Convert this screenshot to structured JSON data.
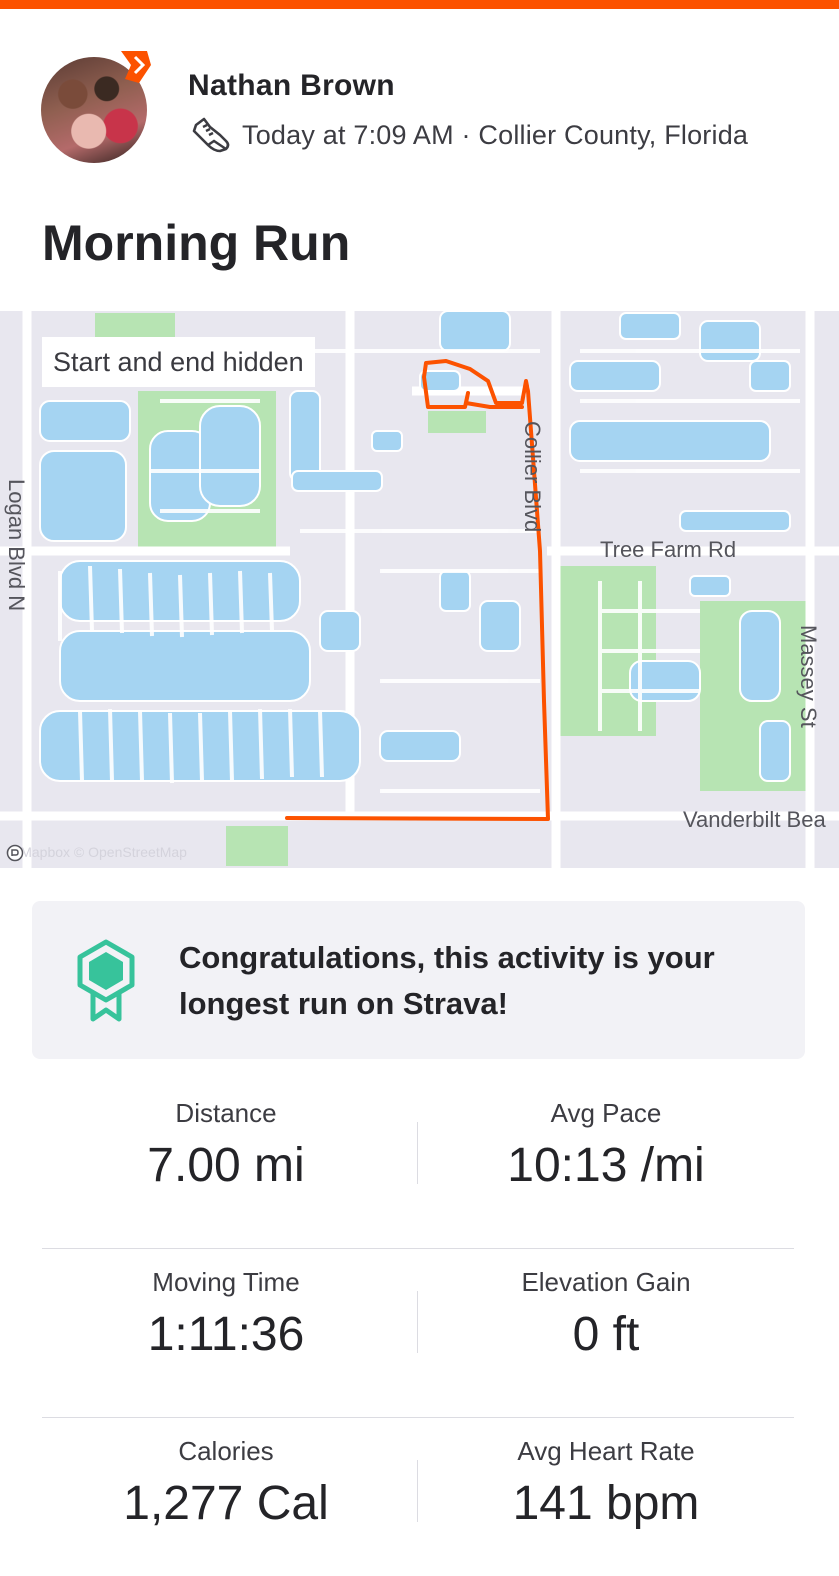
{
  "colors": {
    "accent": "#fc5200",
    "route": "#fc5200",
    "map_water": "#a5d4f2",
    "map_park": "#b7e4b3",
    "map_land": "#e8e7ef",
    "badge_green": "#37c39b"
  },
  "athlete": {
    "name": "Nathan Brown",
    "avatar_icon": "profile-photo",
    "badge_icon": "strava-chevron-icon"
  },
  "activity": {
    "sport_icon": "running-shoe-icon",
    "meta": "Today at 7:09 AM · Collier County, Florida",
    "title": "Morning Run"
  },
  "map": {
    "privacy_label": "Start and end hidden",
    "streets": {
      "logan": "Logan Blvd N",
      "collier": "Collier Blvd",
      "tree_farm": "Tree Farm Rd",
      "massey": "Massey St",
      "vanderbilt": "Vanderbilt Bea"
    },
    "attribution": "© Mapbox © OpenStreetMap"
  },
  "achievement": {
    "icon": "achievement-medal-icon",
    "text": "Congratulations, this activity is your longest run on Strava!"
  },
  "stats": [
    [
      {
        "label": "Distance",
        "value": "7.00 mi"
      },
      {
        "label": "Avg Pace",
        "value": "10:13 /mi"
      }
    ],
    [
      {
        "label": "Moving Time",
        "value": "1:11:36"
      },
      {
        "label": "Elevation Gain",
        "value": "0 ft"
      }
    ],
    [
      {
        "label": "Calories",
        "value": "1,277 Cal"
      },
      {
        "label": "Avg Heart Rate",
        "value": "141 bpm"
      }
    ]
  ]
}
